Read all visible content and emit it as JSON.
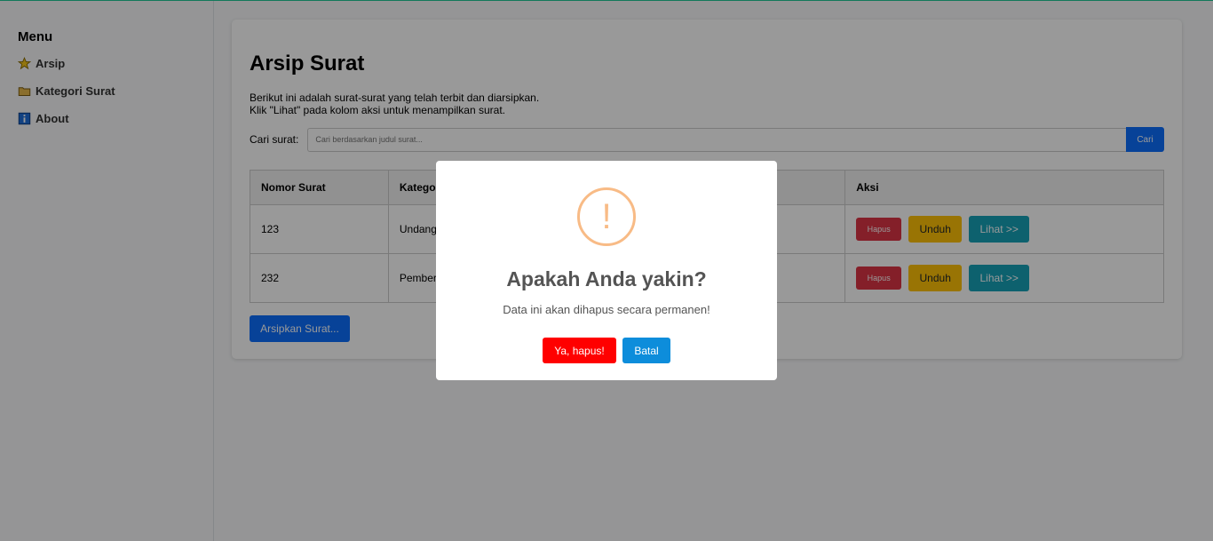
{
  "sidebar": {
    "title": "Menu",
    "items": [
      {
        "label": "Arsip",
        "icon": "star-icon"
      },
      {
        "label": "Kategori Surat",
        "icon": "folder-icon"
      },
      {
        "label": "About",
        "icon": "info-icon"
      }
    ]
  },
  "main": {
    "title": "Arsip Surat",
    "description_line1": "Berikut ini adalah surat-surat yang telah terbit dan diarsipkan.",
    "description_line2": "Klik \"Lihat\" pada kolom aksi untuk menampilkan surat.",
    "search": {
      "label": "Cari surat:",
      "placeholder": "Cari berdasarkan judul surat...",
      "button": "Cari"
    },
    "table": {
      "headers": [
        "Nomor Surat",
        "Katego",
        "Aksi"
      ],
      "rows": [
        {
          "nomor": "123",
          "kategori": "Undang"
        },
        {
          "nomor": "232",
          "kategori": "Pember"
        }
      ],
      "actions": {
        "delete": "Hapus",
        "download": "Unduh",
        "view": "Lihat >>"
      }
    },
    "archive_button": "Arsipkan Surat..."
  },
  "modal": {
    "icon": "!",
    "title": "Apakah Anda yakin?",
    "text": "Data ini akan dihapus secara permanen!",
    "confirm": "Ya, hapus!",
    "cancel": "Batal"
  },
  "colors": {
    "primary": "#0d6efd",
    "danger": "#dc3545",
    "warning": "#ffc107",
    "info": "#17a2b8",
    "confirm": "#ff0000",
    "cancel": "#0d8ddb",
    "warning_icon": "#f8bb86"
  }
}
